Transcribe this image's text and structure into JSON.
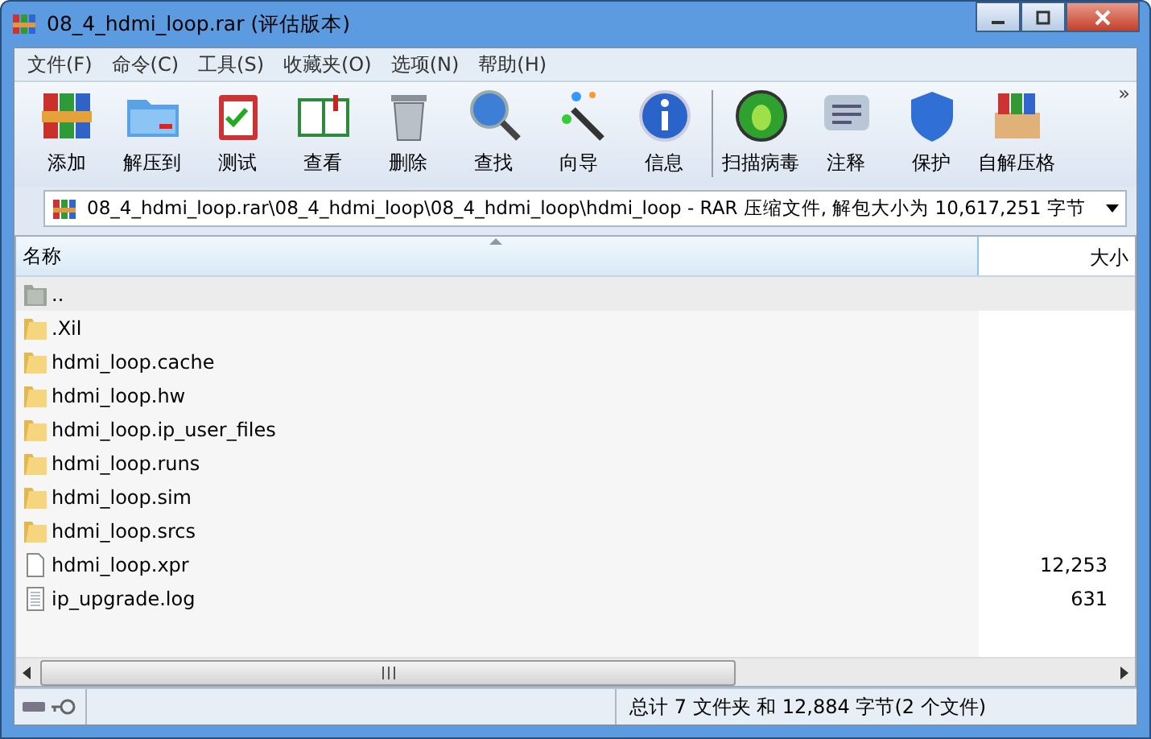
{
  "window": {
    "title": "08_4_hdmi_loop.rar (评估版本)"
  },
  "menu": [
    "文件(F)",
    "命令(C)",
    "工具(S)",
    "收藏夹(O)",
    "选项(N)",
    "帮助(H)"
  ],
  "toolbar": [
    {
      "label": "添加"
    },
    {
      "label": "解压到"
    },
    {
      "label": "测试"
    },
    {
      "label": "查看"
    },
    {
      "label": "删除"
    },
    {
      "label": "查找"
    },
    {
      "label": "向导"
    },
    {
      "label": "信息"
    },
    {
      "label": "扫描病毒"
    },
    {
      "label": "注释"
    },
    {
      "label": "保护"
    },
    {
      "label": "自解压格"
    }
  ],
  "toolbar_overflow": "»",
  "address": {
    "value": "08_4_hdmi_loop.rar\\08_4_hdmi_loop\\08_4_hdmi_loop\\hdmi_loop - RAR 压缩文件, 解包大小为 10,617,251 字节"
  },
  "table": {
    "columns": [
      "名称",
      "大小"
    ],
    "rows": [
      {
        "kind": "up",
        "name": "..",
        "size": "",
        "selected": true
      },
      {
        "kind": "folder",
        "name": ".Xil",
        "size": "",
        "selected": false
      },
      {
        "kind": "folder",
        "name": "hdmi_loop.cache",
        "size": "",
        "selected": false
      },
      {
        "kind": "folder",
        "name": "hdmi_loop.hw",
        "size": "",
        "selected": false
      },
      {
        "kind": "folder",
        "name": "hdmi_loop.ip_user_files",
        "size": "",
        "selected": false
      },
      {
        "kind": "folder",
        "name": "hdmi_loop.runs",
        "size": "",
        "selected": false
      },
      {
        "kind": "folder",
        "name": "hdmi_loop.sim",
        "size": "",
        "selected": false
      },
      {
        "kind": "folder",
        "name": "hdmi_loop.srcs",
        "size": "",
        "selected": false
      },
      {
        "kind": "file",
        "name": "hdmi_loop.xpr",
        "size": "12,253",
        "selected": false
      },
      {
        "kind": "text",
        "name": "ip_upgrade.log",
        "size": "631",
        "selected": false
      }
    ]
  },
  "status_bar": {
    "text": "总计 7 文件夹 和 12,884 字节(2 个文件)"
  }
}
